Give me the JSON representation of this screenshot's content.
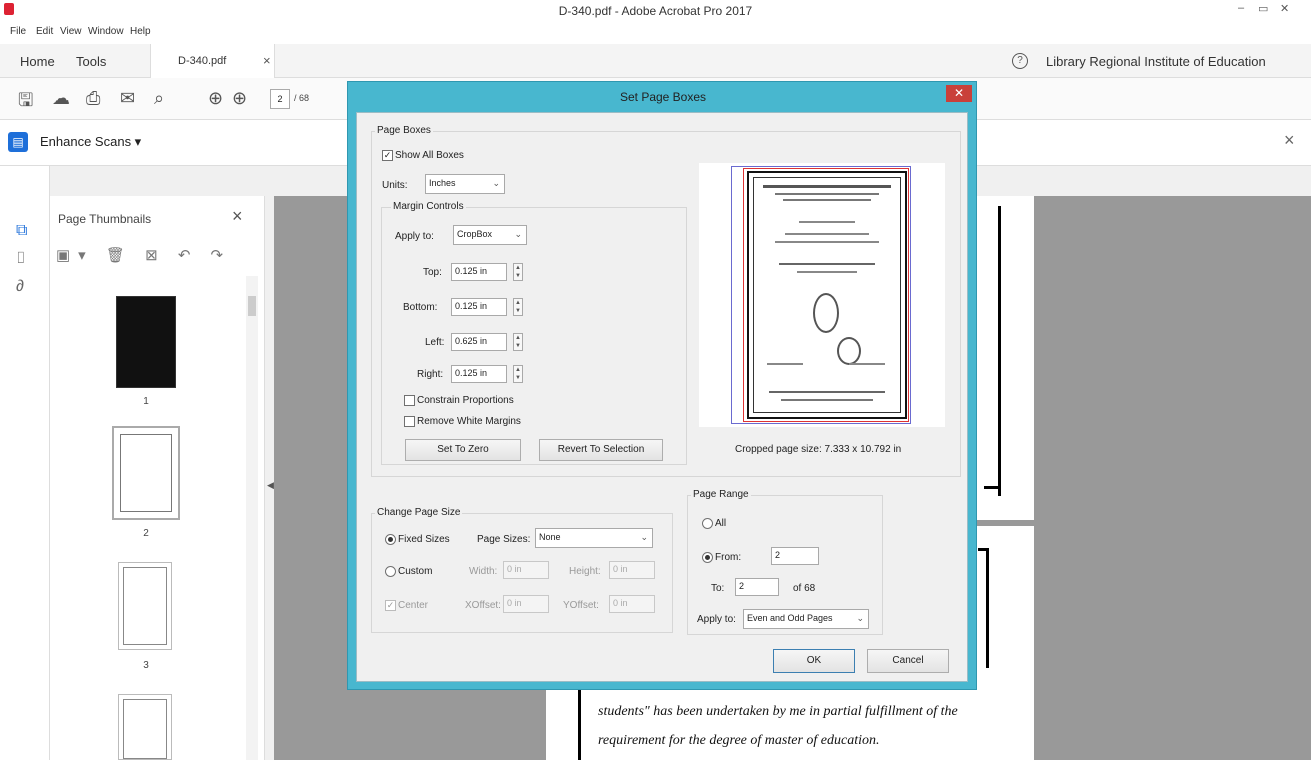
{
  "window": {
    "title": "D-340.pdf - Adobe Acrobat Pro 2017",
    "minimize": "‒",
    "maximize": "▭",
    "close": "✕"
  },
  "menu": [
    "File",
    "Edit",
    "View",
    "Window",
    "Help"
  ],
  "tabs": {
    "home": "Home",
    "tools": "Tools",
    "document": "D-340.pdf",
    "doc_close": "×"
  },
  "account": {
    "help_icon": "?",
    "label": "Library Regional Institute of Education"
  },
  "toolbar": {
    "page_current": "2",
    "page_total": "/ 68"
  },
  "enhance": {
    "label": "Enhance Scans ▾",
    "close": "×"
  },
  "thumbnails": {
    "title": "Page Thumbnails",
    "close": "×",
    "page_numbers": [
      "1",
      "2",
      "3"
    ]
  },
  "document": {
    "line1": "students\" has been undertaken by me in partial fulfillment of the",
    "line2": "requirement for the degree of master of education."
  },
  "dialog": {
    "title": "Set Page Boxes",
    "close": "✕",
    "page_boxes": {
      "title": "Page Boxes",
      "show_all_boxes": "Show All Boxes",
      "units_label": "Units:",
      "units_value": "Inches",
      "margin_controls": {
        "title": "Margin Controls",
        "apply_to_label": "Apply to:",
        "apply_to_value": "CropBox",
        "top_label": "Top:",
        "top_value": "0.125 in",
        "bottom_label": "Bottom:",
        "bottom_value": "0.125 in",
        "left_label": "Left:",
        "left_value": "0.625 in",
        "right_label": "Right:",
        "right_value": "0.125 in",
        "constrain": "Constrain Proportions",
        "remove_white": "Remove White Margins",
        "set_to_zero": "Set To Zero",
        "revert": "Revert To Selection"
      },
      "cropped_size": "Cropped page size: 7.333 x 10.792 in"
    },
    "change_page_size": {
      "title": "Change Page Size",
      "fixed_sizes": "Fixed Sizes",
      "page_sizes_label": "Page Sizes:",
      "page_sizes_value": "None",
      "custom": "Custom",
      "width_label": "Width:",
      "width_value": "0 in",
      "height_label": "Height:",
      "height_value": "0 in",
      "center": "Center",
      "xoffset_label": "XOffset:",
      "xoffset_value": "0 in",
      "yoffset_label": "YOffset:",
      "yoffset_value": "0 in"
    },
    "page_range": {
      "title": "Page Range",
      "all": "All",
      "from_label": "From:",
      "from_value": "2",
      "to_label": "To:",
      "to_value": "2",
      "of_total": "of 68",
      "apply_to_label": "Apply to:",
      "apply_to_value": "Even and Odd Pages"
    },
    "ok": "OK",
    "cancel": "Cancel"
  }
}
